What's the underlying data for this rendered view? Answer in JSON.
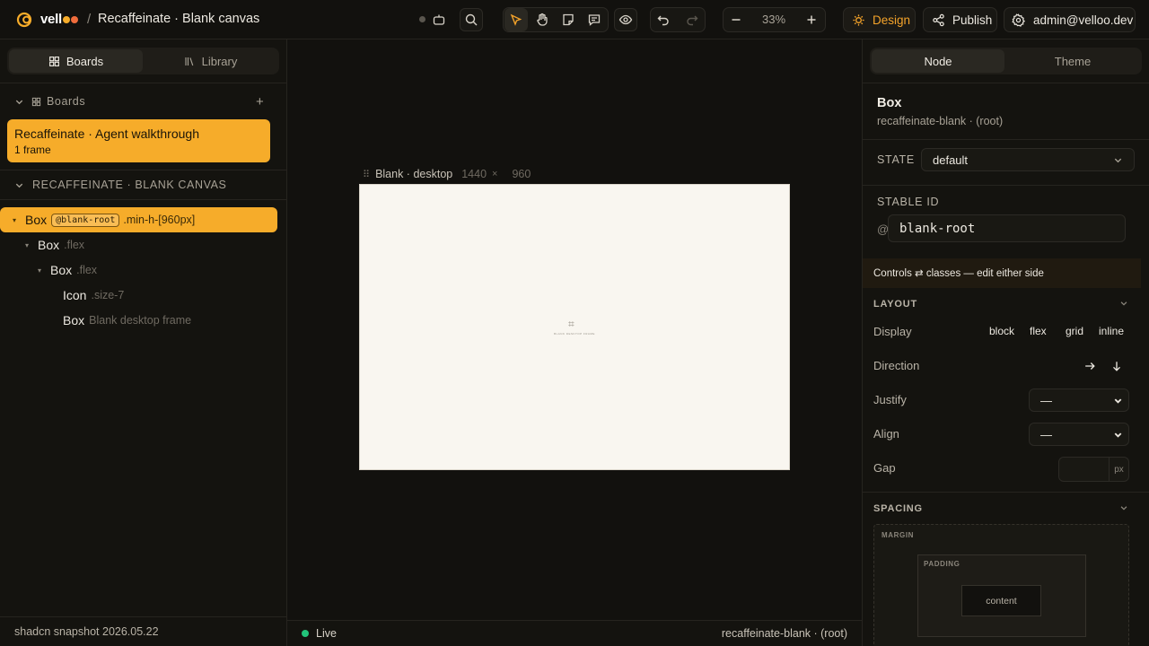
{
  "app": {
    "logo_text": "vell",
    "breadcrumb_sep": "/",
    "title": "Recaffeinate · Blank canvas"
  },
  "toolbar": {
    "zoom_value": "33%",
    "design_label": "Design",
    "publish_label": "Publish",
    "account_label": "admin@velloo.dev"
  },
  "left": {
    "tabs": [
      {
        "label": "Boards",
        "active": true
      },
      {
        "label": "Library",
        "active": false
      }
    ],
    "boards_section_label": "Boards",
    "add_symbol": "+",
    "board_card": {
      "title": "Recaffeinate · Agent walkthrough",
      "subtitle": "1 frame"
    },
    "layers_section_label": "RECAFFEINATE · BLANK CANVAS",
    "tree": [
      {
        "name": "Box",
        "id": "@blank-root",
        "cls": ".min-h-[960px]"
      },
      {
        "name": "Box",
        "cls": ".flex"
      },
      {
        "name": "Box",
        "cls": ".flex"
      },
      {
        "name": "Icon",
        "cls": ".size-7"
      },
      {
        "name": "Box",
        "cls": "Blank desktop frame"
      }
    ],
    "footer": "shadcn snapshot 2026.05.22"
  },
  "canvas": {
    "frame_name": "Blank · desktop",
    "frame_width": "1440",
    "times": "×",
    "frame_height": "960",
    "frame_icon": "⌗",
    "frame_caption": "BLANK DESKTOP FRAME",
    "status": "Live",
    "selection_path": "recaffeinate-blank · (root)"
  },
  "right": {
    "tabs": [
      {
        "label": "Node",
        "active": true
      },
      {
        "label": "Theme",
        "active": false
      }
    ],
    "node_title": "Box",
    "node_sub": "recaffeinate-blank · (root)",
    "state_label": "STATE",
    "state_value": "default",
    "stable_id_label": "STABLE ID",
    "id_prefix": "@",
    "stable_id_value": "blank-root",
    "controls_note": "Controls ⇄ classes — edit either side",
    "layout_label": "LAYOUT",
    "display_label": "Display",
    "display_options": [
      "block",
      "flex",
      "grid",
      "inline"
    ],
    "direction_label": "Direction",
    "justify_label": "Justify",
    "justify_value": "—",
    "align_label": "Align",
    "align_value": "—",
    "gap_label": "Gap",
    "gap_value": "",
    "gap_unit": "px",
    "spacing_label": "SPACING",
    "margin_label": "MARGIN",
    "padding_label": "PADDING",
    "content_label": "content"
  },
  "colors": {
    "accent": "#f6ac2a",
    "background": "#12110e",
    "panel": "#14130f",
    "live": "#22c47a"
  }
}
